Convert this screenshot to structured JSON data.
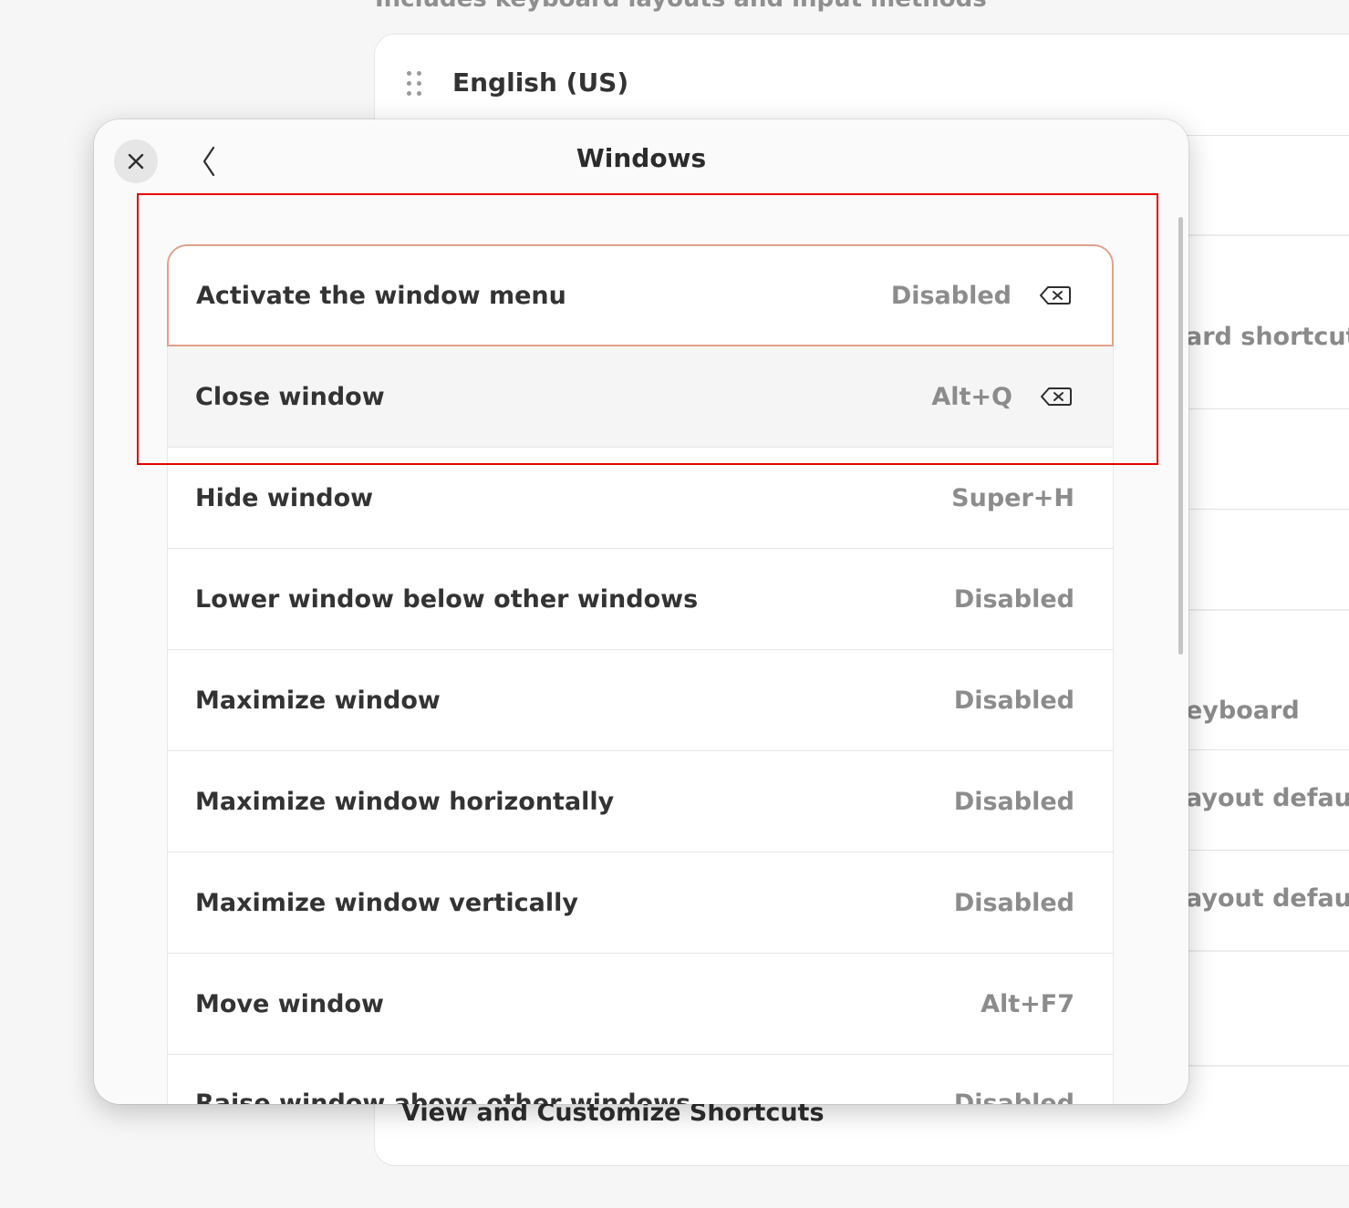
{
  "background": {
    "subtitle": "Includes keyboard layouts and input methods",
    "input_source": "English (US)",
    "partial_texts": {
      "keyboard_shortcuts": "ard shortcut",
      "keyboard": "eyboard",
      "layout_default_1": "ayout defaul",
      "layout_default_2": "ayout defaul"
    },
    "shortcuts_link": "View and Customize Shortcuts"
  },
  "dialog": {
    "title": "Windows",
    "close_icon": "close-icon",
    "back_icon": "chevron-left-icon"
  },
  "shortcuts": [
    {
      "label": "Activate the window menu",
      "value": "Disabled",
      "clearable": true
    },
    {
      "label": "Close window",
      "value": "Alt+Q",
      "clearable": true
    },
    {
      "label": "Hide window",
      "value": "Super+H",
      "clearable": false
    },
    {
      "label": "Lower window below other windows",
      "value": "Disabled",
      "clearable": false
    },
    {
      "label": "Maximize window",
      "value": "Disabled",
      "clearable": false
    },
    {
      "label": "Maximize window horizontally",
      "value": "Disabled",
      "clearable": false
    },
    {
      "label": "Maximize window vertically",
      "value": "Disabled",
      "clearable": false
    },
    {
      "label": "Move window",
      "value": "Alt+F7",
      "clearable": false
    },
    {
      "label": "Raise window above other windows",
      "value": "Disabled",
      "clearable": false
    }
  ],
  "colors": {
    "accent_focus": "#e3a08a",
    "highlight": "#e60000"
  }
}
